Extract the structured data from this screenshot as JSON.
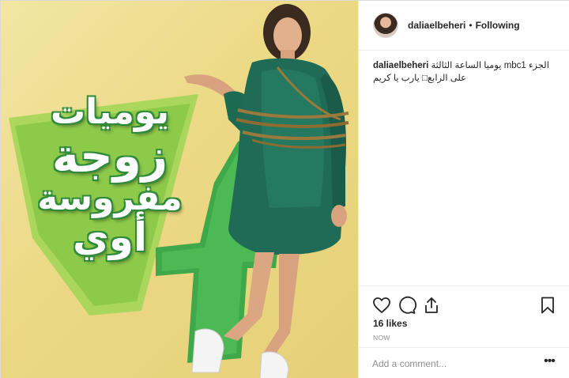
{
  "post": {
    "poster_title_lines": [
      "يوميات",
      "زوجة",
      "مفروسة",
      "أوي"
    ],
    "poster_number": "4",
    "colors": {
      "background": "#ecd985",
      "green_dark": "#2f8a3a",
      "green_light": "#5fc06a",
      "dress": "#1f6b55"
    }
  },
  "header": {
    "avatar_icon": "profile-avatar",
    "username": "daliaelbeheri",
    "separator": "•",
    "follow_label": "Following"
  },
  "caption": {
    "username": "daliaelbeheri",
    "text": "الجزء mbc1 يوميا الساعة الثالثة على الرابع□ يارب يا كريم"
  },
  "actions": {
    "icons": [
      "heart-icon",
      "comment-icon",
      "share-icon",
      "bookmark-icon"
    ],
    "likes": "16 likes",
    "time": "NOW"
  },
  "comment_box": {
    "placeholder": "Add a comment...",
    "more_label": "•••"
  }
}
